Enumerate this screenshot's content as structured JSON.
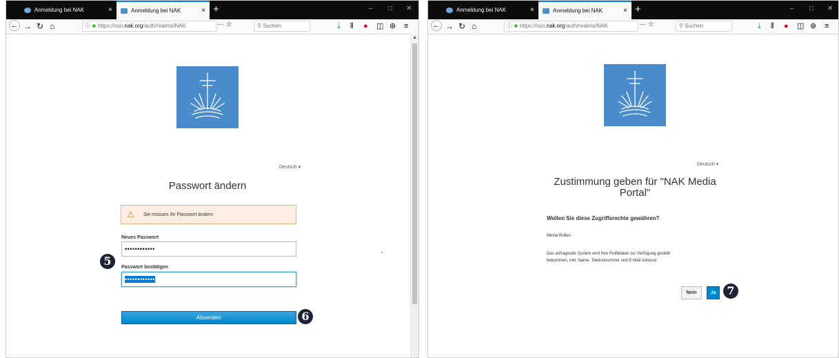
{
  "left": {
    "tabs": [
      {
        "label": "Anmeldung bei NAK",
        "close": "×"
      },
      {
        "label": "Anmeldung bei NAK",
        "close": "×"
      }
    ],
    "new_tab": "+",
    "window_controls": {
      "minimize": "–",
      "maximize": "□",
      "close": "✕"
    },
    "url": {
      "info": "ⓘ",
      "lock": "🔒",
      "prefix": "https://sso.",
      "host": "nak.org",
      "path": "/auth/realms/NAK",
      "actions": "···  ☆"
    },
    "search_placeholder": "Suchen",
    "language": "Deutsch ▾",
    "title": "Passwort ändern",
    "alert": "Sie müssen Ihr Passwort ändern",
    "new_password_label": "Neues Passwort",
    "new_password_value": "••••••••••••",
    "confirm_password_label": "Passwort bestätigen",
    "confirm_password_value": "••••••••••••",
    "submit_label": "Absenden",
    "markers": [
      "5",
      "6"
    ]
  },
  "right": {
    "tabs": [
      {
        "label": "Anmeldung bei NAK",
        "close": "×"
      },
      {
        "label": "Anmeldung bei NAK",
        "close": "×"
      }
    ],
    "new_tab": "+",
    "window_controls": {
      "minimize": "–",
      "maximize": "□",
      "close": "✕"
    },
    "url": {
      "info": "ⓘ",
      "lock": "🔒",
      "prefix": "https://sso.",
      "host": "nak.org",
      "path": "/auth/realms/NAK",
      "actions": "···  ☆"
    },
    "search_placeholder": "Suchen",
    "language": "Deutsch ▾",
    "title_line1": "Zustimmung geben für \"NAK Media",
    "title_line2": "Portal\"",
    "question": "Wollen Sie diese Zugriffsrechte gewähren?",
    "roles": "Meine Rollen",
    "info_line1": "Das anfragende System wird Ihre Profildaten zur Verfügung gestellt",
    "info_line2": "bekommen, inkl. Name, Telefonnummer und E-Mail Adresse.",
    "no_label": "Nein",
    "yes_label": "Ja",
    "marker": "7"
  },
  "colors": {
    "accent": "#0088ce",
    "logo": "#4a8ccb",
    "alert_border": "#f5ad74",
    "alert_bg": "#fdeee2",
    "marker": "#1c2433"
  },
  "icons": [
    "back-icon",
    "forward-icon",
    "reload-icon",
    "home-icon",
    "download-icon",
    "library-icon",
    "shield-icon",
    "sidebar-icon",
    "account-icon",
    "menu-icon",
    "warning-icon",
    "nak-logo"
  ]
}
